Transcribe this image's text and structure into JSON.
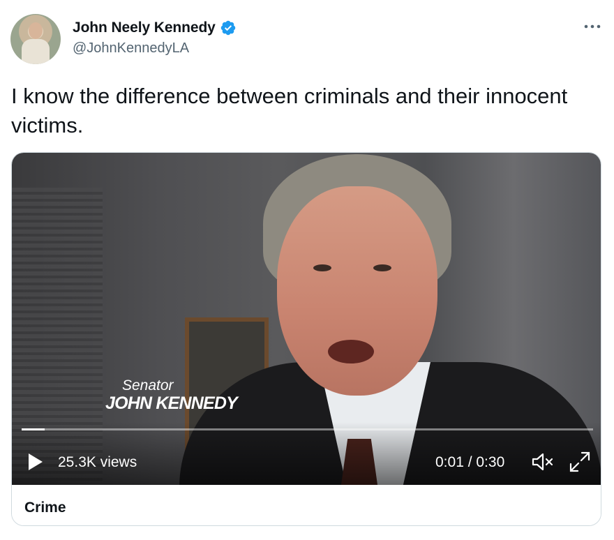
{
  "author": {
    "display_name": "John Neely Kennedy",
    "handle": "@JohnKennedyLA",
    "verified": true,
    "verified_color": "#1d9bf0"
  },
  "tweet": {
    "text": "I know the difference between criminals and their innocent victims."
  },
  "video": {
    "chyron_title": "Senator",
    "chyron_name": "JOHN KENNEDY",
    "views": "25.3K views",
    "time": "0:01 / 0:30",
    "progress": 0.04,
    "muted": true
  },
  "card": {
    "topic": "Crime"
  },
  "icons": {
    "more": "more-dots-icon",
    "play": "play-icon",
    "mute": "muted-speaker-icon",
    "fullscreen": "fullscreen-icon",
    "verified": "verified-badge-icon"
  }
}
